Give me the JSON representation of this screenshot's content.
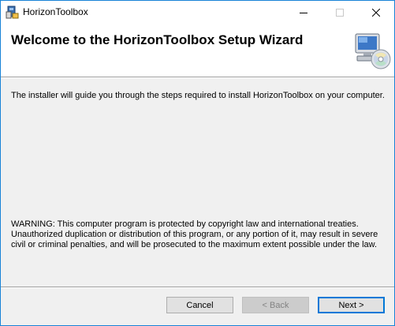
{
  "window": {
    "title": "HorizonToolbox",
    "controls": {
      "minimize": "minimize-icon",
      "maximize": "maximize-icon",
      "close": "close-icon"
    }
  },
  "header": {
    "title": "Welcome to the HorizonToolbox Setup Wizard",
    "graphic": "computer-cd-icon"
  },
  "body": {
    "intro": "The installer will guide you through the steps required to install HorizonToolbox on your computer.",
    "warning": "WARNING: This computer program is protected by copyright law and international treaties. Unauthorized duplication or distribution of this program, or any portion of it, may result in severe civil or criminal penalties, and will be prosecuted to the maximum extent possible under the law."
  },
  "buttons": {
    "cancel": "Cancel",
    "back": "< Back",
    "next": "Next >"
  },
  "colors": {
    "window_border": "#1883d7",
    "dialog_bg": "#f0f0f0",
    "default_button_border": "#0078d7"
  }
}
